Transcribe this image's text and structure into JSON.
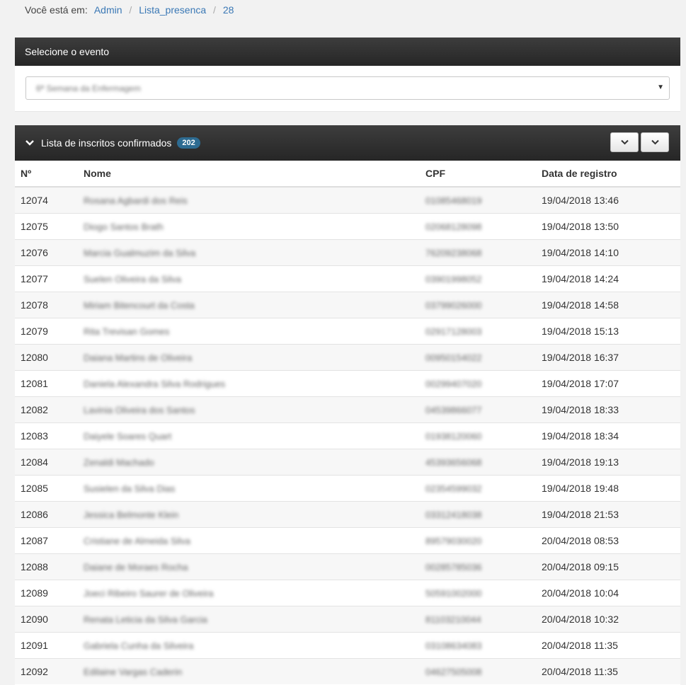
{
  "breadcrumb": {
    "label": "Você está em:",
    "items": [
      "Admin",
      "Lista_presenca",
      "28"
    ]
  },
  "event_panel": {
    "title": "Selecione o evento",
    "select_value": "6ª Semana da Enfermagem"
  },
  "list_panel": {
    "title": "Lista de inscritos confirmados",
    "count": "202",
    "columns": [
      "Nº",
      "Nome",
      "CPF",
      "Data de registro"
    ],
    "rows": [
      {
        "n": "12074",
        "nome": "Rosana Agbardi dos Reis",
        "cpf": "01085468019",
        "data": "19/04/2018 13:46"
      },
      {
        "n": "12075",
        "nome": "Diogo Santos Brath",
        "cpf": "02068128098",
        "data": "19/04/2018 13:50"
      },
      {
        "n": "12076",
        "nome": "Marcia Gualmuzim da Silva",
        "cpf": "76209238068",
        "data": "19/04/2018 14:10"
      },
      {
        "n": "12077",
        "nome": "Suelen Oliveira da Silva",
        "cpf": "03901998052",
        "data": "19/04/2018 14:24"
      },
      {
        "n": "12078",
        "nome": "Miriam Bitencourt da Costa",
        "cpf": "03799026000",
        "data": "19/04/2018 14:58"
      },
      {
        "n": "12079",
        "nome": "Rita Trevisan Gomes",
        "cpf": "02917128003",
        "data": "19/04/2018 15:13"
      },
      {
        "n": "12080",
        "nome": "Daiana Martins de Oliveira",
        "cpf": "00950154022",
        "data": "19/04/2018 16:37"
      },
      {
        "n": "12081",
        "nome": "Daniela Alexandra Silva Rodrigues",
        "cpf": "00299407020",
        "data": "19/04/2018 17:07"
      },
      {
        "n": "12082",
        "nome": "Lavinia Oliveira dos Santos",
        "cpf": "04539866077",
        "data": "19/04/2018 18:33"
      },
      {
        "n": "12083",
        "nome": "Daiyele Soares Quart",
        "cpf": "01938120060",
        "data": "19/04/2018 18:34"
      },
      {
        "n": "12084",
        "nome": "Zenaldi Machado",
        "cpf": "45393656068",
        "data": "19/04/2018 19:13"
      },
      {
        "n": "12085",
        "nome": "Susielen da Silva Dias",
        "cpf": "02354599032",
        "data": "19/04/2018 19:48"
      },
      {
        "n": "12086",
        "nome": "Jessica Belmonte Klein",
        "cpf": "03312418038",
        "data": "19/04/2018 21:53"
      },
      {
        "n": "12087",
        "nome": "Cristiane de Almeida Silva",
        "cpf": "89579030020",
        "data": "20/04/2018 08:53"
      },
      {
        "n": "12088",
        "nome": "Daiane de Moraes Rocha",
        "cpf": "00285785036",
        "data": "20/04/2018 09:15"
      },
      {
        "n": "12089",
        "nome": "Joeci Ribeiro Saurer de Oliveira",
        "cpf": "50591002000",
        "data": "20/04/2018 10:04"
      },
      {
        "n": "12090",
        "nome": "Renata Leticia da Silva Garcia",
        "cpf": "81103210044",
        "data": "20/04/2018 10:32"
      },
      {
        "n": "12091",
        "nome": "Gabriela Cunha da Silveira",
        "cpf": "03108634083",
        "data": "20/04/2018 11:35"
      },
      {
        "n": "12092",
        "nome": "Edilaine Vargas Caderin",
        "cpf": "04627505008",
        "data": "20/04/2018 11:35"
      }
    ]
  },
  "icons": {
    "collapse": "chevron-down-icon",
    "select_caret": "caret-down-icon"
  },
  "colors": {
    "header_bg": "#2b2b2b",
    "link": "#3a78b5",
    "badge": "#2d6b91"
  }
}
